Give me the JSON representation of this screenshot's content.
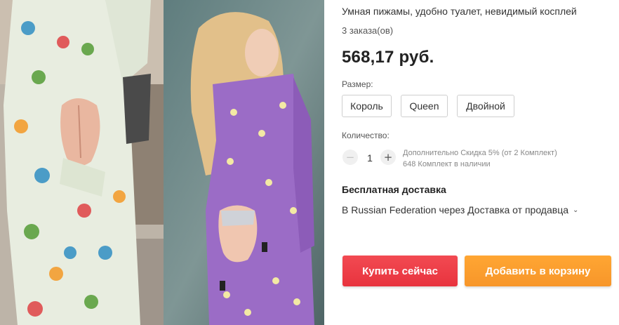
{
  "product": {
    "title": "Умная пижамы, удобно туалет, невидимый косплей",
    "orders": "3 заказа(ов)",
    "price": "568,17 руб."
  },
  "size": {
    "label": "Размер:",
    "options": [
      "Король",
      "Queen",
      "Двойной"
    ]
  },
  "quantity": {
    "label": "Количество:",
    "minus": "−",
    "plus": "+",
    "value": "1",
    "discount_note": "Дополнительно Скидка 5% (от 2 Комплект)",
    "stock_note": "648 Комплект в наличии"
  },
  "shipping": {
    "title": "Бесплатная доставка",
    "description": "В Russian Federation через Доставка от продавца",
    "chevron_icon": "chevron-down-icon"
  },
  "actions": {
    "buy_now": "Купить сейчас",
    "add_to_cart": "Добавить в корзину"
  },
  "colors": {
    "buy_button": "#f3454f",
    "cart_button": "#ffa030",
    "pajama_light": "#e7ecdf",
    "pajama_purple": "#9b6cc6"
  }
}
